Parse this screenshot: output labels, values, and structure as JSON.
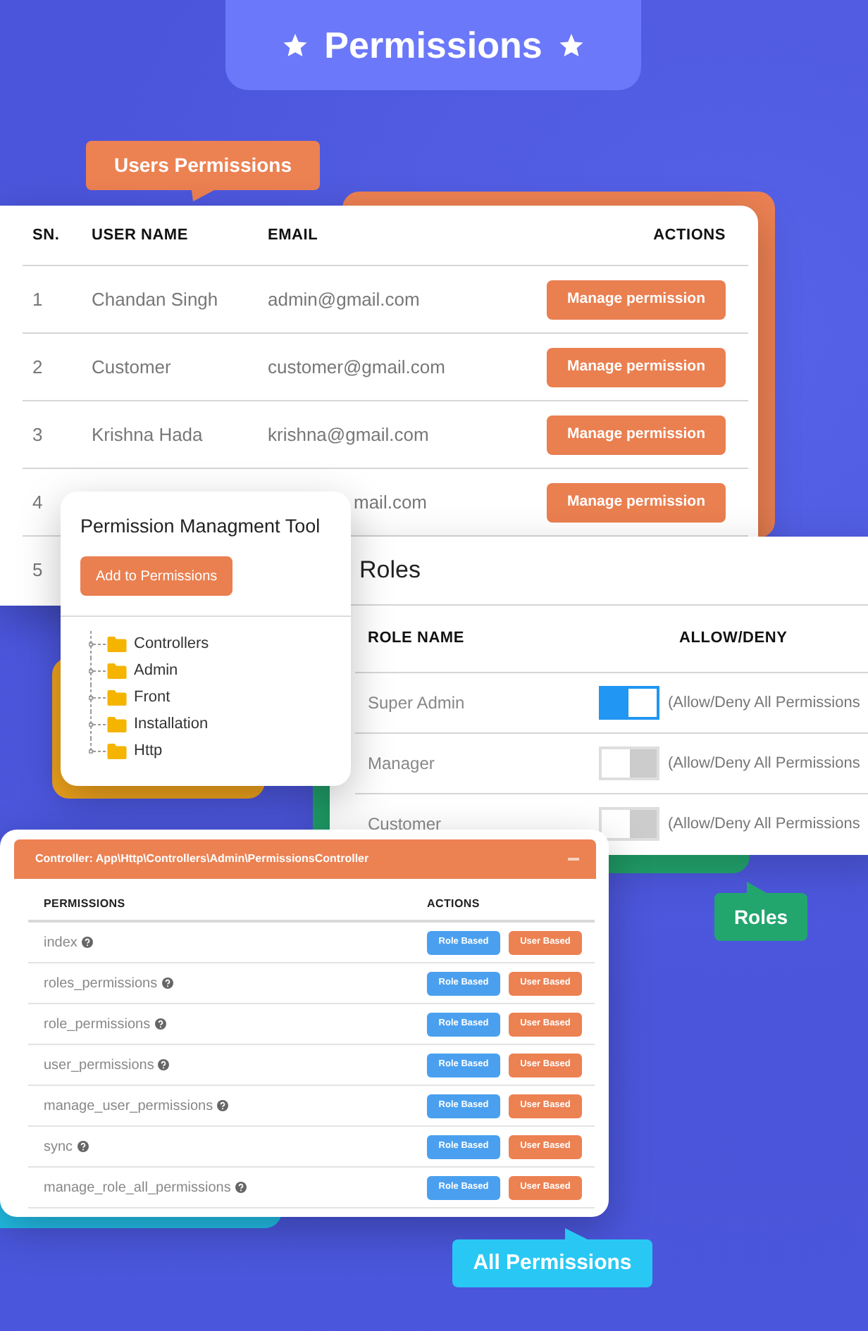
{
  "banner": {
    "title": "Permissions"
  },
  "users_panel": {
    "callout": "Users Permissions",
    "columns": [
      "SN.",
      "USER NAME",
      "EMAIL",
      "ACTIONS"
    ],
    "rows": [
      {
        "sn": "1",
        "user_name": "Chandan Singh",
        "email": "admin@gmail.com",
        "action": "Manage permission"
      },
      {
        "sn": "2",
        "user_name": "Customer",
        "email": "customer@gmail.com",
        "action": "Manage permission"
      },
      {
        "sn": "3",
        "user_name": "Krishna Hada",
        "email": "krishna@gmail.com",
        "action": "Manage permission"
      },
      {
        "sn": "4",
        "email": "mail.com",
        "action": "Manage permission"
      },
      {
        "sn": "5"
      }
    ]
  },
  "tool_panel": {
    "title": "Permission Managment Tool",
    "button": "Add to Permissions",
    "tree": [
      {
        "label": "Controllers"
      },
      {
        "label": "Admin"
      },
      {
        "label": "Front"
      },
      {
        "label": "Installation"
      },
      {
        "label": "Http"
      }
    ]
  },
  "roles_panel": {
    "title": "Roles",
    "callout": "Roles",
    "columns": [
      "ROLE NAME",
      "ALLOW/DENY"
    ],
    "rows": [
      {
        "role": "Super Admin",
        "on": true,
        "label": "(Allow/Deny All Permissions"
      },
      {
        "role": "Manager",
        "on": false,
        "label": "(Allow/Deny All Permissions"
      },
      {
        "role": "Customer",
        "on": false,
        "label": "(Allow/Deny All Permissions"
      }
    ]
  },
  "permissions_panel": {
    "callout": "All Permissions",
    "header": "Controller: App\\Http\\Controllers\\Admin\\PermissionsController",
    "columns": [
      "PERMISSIONS",
      "ACTIONS"
    ],
    "rows": [
      {
        "name": "index",
        "buttons": [
          {
            "label": "Role Based",
            "kind": "role"
          },
          {
            "label": "User Based",
            "kind": "user"
          }
        ]
      },
      {
        "name": "roles_permissions",
        "buttons": [
          {
            "label": "Role Based",
            "kind": "role"
          },
          {
            "label": "User Based",
            "kind": "user"
          }
        ]
      },
      {
        "name": "role_permissions",
        "buttons": [
          {
            "label": "Role Based",
            "kind": "role"
          },
          {
            "label": "User Based",
            "kind": "user"
          }
        ]
      },
      {
        "name": "user_permissions",
        "buttons": [
          {
            "label": "Role Based",
            "kind": "role"
          },
          {
            "label": "User Based",
            "kind": "user"
          }
        ]
      },
      {
        "name": "manage_user_permissions",
        "buttons": [
          {
            "label": "Role Based",
            "kind": "role"
          },
          {
            "label": "User Based",
            "kind": "user"
          }
        ]
      },
      {
        "name": "sync",
        "buttons": [
          {
            "label": "Role Based",
            "kind": "role"
          },
          {
            "label": "User Based",
            "kind": "user"
          }
        ]
      },
      {
        "name": "manage_role_all_permissions",
        "buttons": [
          {
            "label": "Role Based",
            "kind": "role"
          },
          {
            "label": "User Based",
            "kind": "user"
          }
        ]
      }
    ]
  }
}
